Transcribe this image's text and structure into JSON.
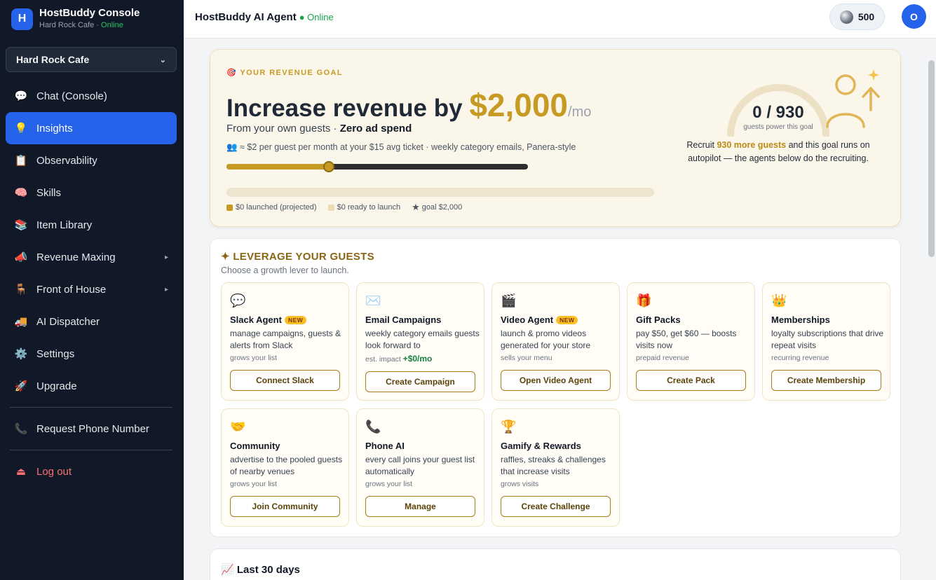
{
  "brand": {
    "logo_letter": "H",
    "title": "HostBuddy Console",
    "venue": "Hard Rock Cafe",
    "separator": " · ",
    "status": "Online"
  },
  "venue_select": {
    "value": "Hard Rock Cafe"
  },
  "nav": {
    "items": [
      {
        "icon": "💬",
        "label": "Chat (Console)"
      },
      {
        "icon": "💡",
        "label": "Insights"
      },
      {
        "icon": "📋",
        "label": "Observability"
      },
      {
        "icon": "🧠",
        "label": "Skills"
      },
      {
        "icon": "📚",
        "label": "Item Library"
      },
      {
        "icon": "📣",
        "label": "Revenue Maxing"
      },
      {
        "icon": "🪑",
        "label": "Front of House"
      },
      {
        "icon": "🚚",
        "label": "AI Dispatcher"
      },
      {
        "icon": "⚙️",
        "label": "Settings"
      },
      {
        "icon": "🚀",
        "label": "Upgrade"
      }
    ],
    "phone": {
      "icon": "📞",
      "label": "Request Phone Number"
    },
    "logout": {
      "icon": "⏏",
      "label": "Log out"
    }
  },
  "header": {
    "title": "HostBuddy AI Agent",
    "status": "● Online",
    "credits": "500",
    "avatar_initial": "O"
  },
  "goal": {
    "eyebrow": "🎯 YOUR REVENUE GOAL",
    "headline_prefix": "Increase revenue by ",
    "amount": "$2,000",
    "per": "/mo",
    "sub_prefix": "From your own guests · ",
    "sub_bold": "Zero ad spend",
    "note": "👥 ≈ $2 per guest per month at your $15 avg ticket · weekly category emails, Panera-style",
    "slider_fraction": 0.34,
    "progress_fraction": 0,
    "legend": {
      "launched": "$0 launched (projected)",
      "ready": "$0 ready to launch",
      "goal": "goal $2,000"
    },
    "gauge": {
      "value": "0 / 930",
      "caption": "guests power this goal"
    },
    "recruit_prefix": "Recruit ",
    "recruit_bold": "930 more guests",
    "recruit_suffix": " and this goal runs on autopilot — the agents below do the recruiting."
  },
  "leverage": {
    "title": "✦ LEVERAGE YOUR GUESTS",
    "subtitle": "Choose a growth lever to launch.",
    "new_badge": "NEW",
    "levers": [
      {
        "icon": "💬",
        "name": "Slack Agent",
        "desc": "manage campaigns, guests & alerts from Slack",
        "foot": "grows your list",
        "button": "Connect Slack"
      },
      {
        "icon": "✉️",
        "name": "Email Campaigns",
        "desc": "weekly category emails guests look forward to",
        "foot": "est. impact ",
        "impact": "+$0/mo",
        "button": "Create Campaign"
      },
      {
        "icon": "🎬",
        "name": "Video Agent",
        "desc": "launch & promo videos generated for your store",
        "foot": "sells your menu",
        "button": "Open Video Agent"
      },
      {
        "icon": "🎁",
        "name": "Gift Packs",
        "desc": "pay $50, get $60 — boosts visits now",
        "foot": "prepaid revenue",
        "button": "Create Pack"
      },
      {
        "icon": "👑",
        "name": "Memberships",
        "desc": "loyalty subscriptions that drive repeat visits",
        "foot": "recurring revenue",
        "button": "Create Membership"
      },
      {
        "icon": "🤝",
        "name": "Community",
        "desc": "advertise to the pooled guests of nearby venues",
        "foot": "grows your list",
        "button": "Join Community"
      },
      {
        "icon": "📞",
        "name": "Phone AI",
        "desc": "every call joins your guest list automatically",
        "foot": "grows your list",
        "button": "Manage"
      },
      {
        "icon": "🏆",
        "name": "Gamify & Rewards",
        "desc": "raffles, streaks & challenges that increase visits",
        "foot": "grows visits",
        "button": "Create Challenge"
      }
    ]
  },
  "last30": {
    "title": "📈 Last 30 days"
  },
  "colors": {
    "accent": "#2563eb",
    "gold": "#c79a23",
    "sidebar": "#111827",
    "online": "#22c55e"
  }
}
